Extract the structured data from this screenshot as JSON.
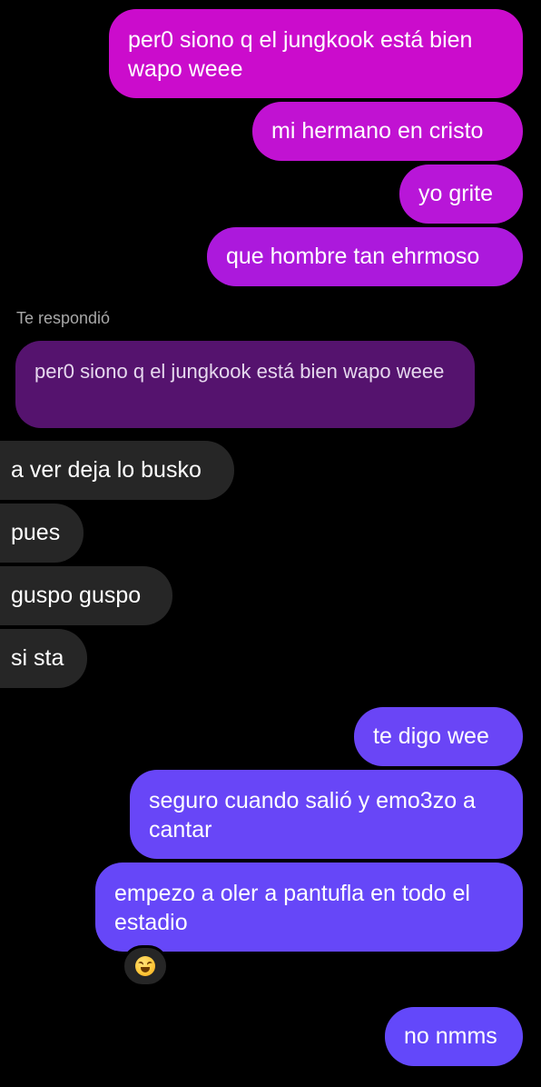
{
  "messages_outgoing_top": [
    {
      "text": "per0 siono q el jungkook está bien wapo weee"
    },
    {
      "text": "mi hermano en cristo"
    },
    {
      "text": "yo grite"
    },
    {
      "text": "que hombre tan ehrmoso"
    }
  ],
  "reply": {
    "label": "Te respondió",
    "quoted_text": "per0 siono q el jungkook está bien wapo weee"
  },
  "messages_incoming": [
    {
      "text": "a ver deja lo busko"
    },
    {
      "text": "pues"
    },
    {
      "text": "guspo guspo"
    },
    {
      "text": "si sta"
    }
  ],
  "messages_outgoing_bottom": [
    {
      "text": "te digo wee"
    },
    {
      "text": "seguro cuando salió y emo3zo a cantar"
    },
    {
      "text": "empezo a oler a pantufla en todo el estadio"
    },
    {
      "text": "no nmms"
    }
  ],
  "reaction": {
    "icon": "grinning-squinting-face-emoji"
  },
  "colors": {
    "gradient_top": "#d10fc8",
    "gradient_mid": "#a11be3",
    "gradient_bottom": "#6347fa",
    "incoming_bubble": "#262626",
    "reply_quote_bg": "#55136e",
    "background": "#000000"
  }
}
